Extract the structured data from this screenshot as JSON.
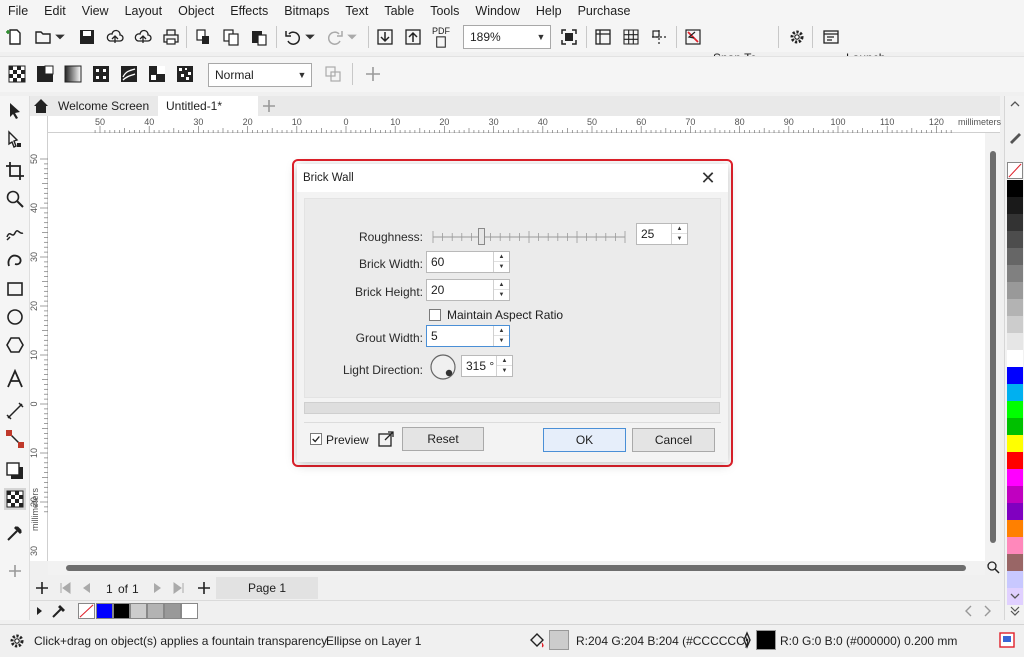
{
  "menu": [
    "File",
    "Edit",
    "View",
    "Layout",
    "Object",
    "Effects",
    "Bitmaps",
    "Text",
    "Table",
    "Tools",
    "Window",
    "Help",
    "Purchase"
  ],
  "toolbar": {
    "zoom_value": "189%",
    "pdf_label": "PDF",
    "snap_to_label": "Snap To",
    "launch_label": "Launch"
  },
  "propertybar": {
    "merge_mode": "Normal"
  },
  "doc_tabs": {
    "welcome": "Welcome Screen",
    "current": "Untitled-1*"
  },
  "ruler": {
    "units": "millimeters",
    "h_labels": [
      "50",
      "40",
      "30",
      "20",
      "10",
      "0",
      "10",
      "20",
      "30",
      "40",
      "50",
      "60",
      "70",
      "80",
      "90",
      "100",
      "110",
      "120"
    ],
    "v_labels": [
      "50",
      "40",
      "30",
      "20",
      "10",
      "0",
      "10",
      "20",
      "30",
      "40",
      "50"
    ]
  },
  "page_nav": {
    "current": "1",
    "of_label": "of",
    "total": "1",
    "page_tab": "Page 1"
  },
  "status": {
    "hint": "Click+drag on object(s) applies a fountain transparency",
    "object_info": "Ellipse on Layer 1",
    "fill_info": "R:204 G:204 B:204 (#CCCCCC)",
    "outline_info": "R:0 G:0 B:0 (#000000)  0.200 mm"
  },
  "dialog": {
    "title": "Brick Wall",
    "roughness_label": "Roughness:",
    "roughness_value": "25",
    "roughness_fraction": 0.25,
    "brick_width_label": "Brick Width:",
    "brick_width_value": "60",
    "brick_height_label": "Brick Height:",
    "brick_height_value": "20",
    "maintain_aspect_label": "Maintain Aspect Ratio",
    "maintain_aspect_checked": false,
    "grout_width_label": "Grout Width:",
    "grout_width_value": "5",
    "light_direction_label": "Light Direction:",
    "light_direction_value": "315 °",
    "preview_label": "Preview",
    "preview_checked": true,
    "reset_label": "Reset",
    "ok_label": "OK",
    "cancel_label": "Cancel"
  },
  "colors": {
    "accent": "#e0202a",
    "focus": "#4a8fd6",
    "fill_swatch": "#CCCCCC",
    "outline_swatch": "#000000",
    "palette": [
      "#ffffff",
      "#000000",
      "#1a1a1a",
      "#333333",
      "#4d4d4d",
      "#666666",
      "#808080",
      "#999999",
      "#b3b3b3",
      "#cccccc",
      "#e6e6e6",
      "#ffffff",
      "#0000ff",
      "#00b0f0",
      "#00ff00",
      "#00c000",
      "#ffff00",
      "#ff0000",
      "#ff00ff",
      "#c000c0",
      "#8000c0",
      "#ff8000",
      "#ff88bb",
      "#996666",
      "#c8c8ff",
      "#e0d0ff"
    ],
    "doc_palette": [
      "#0000ff",
      "#000000",
      "#cccccc",
      "#b3b3b3",
      "#999999"
    ]
  }
}
